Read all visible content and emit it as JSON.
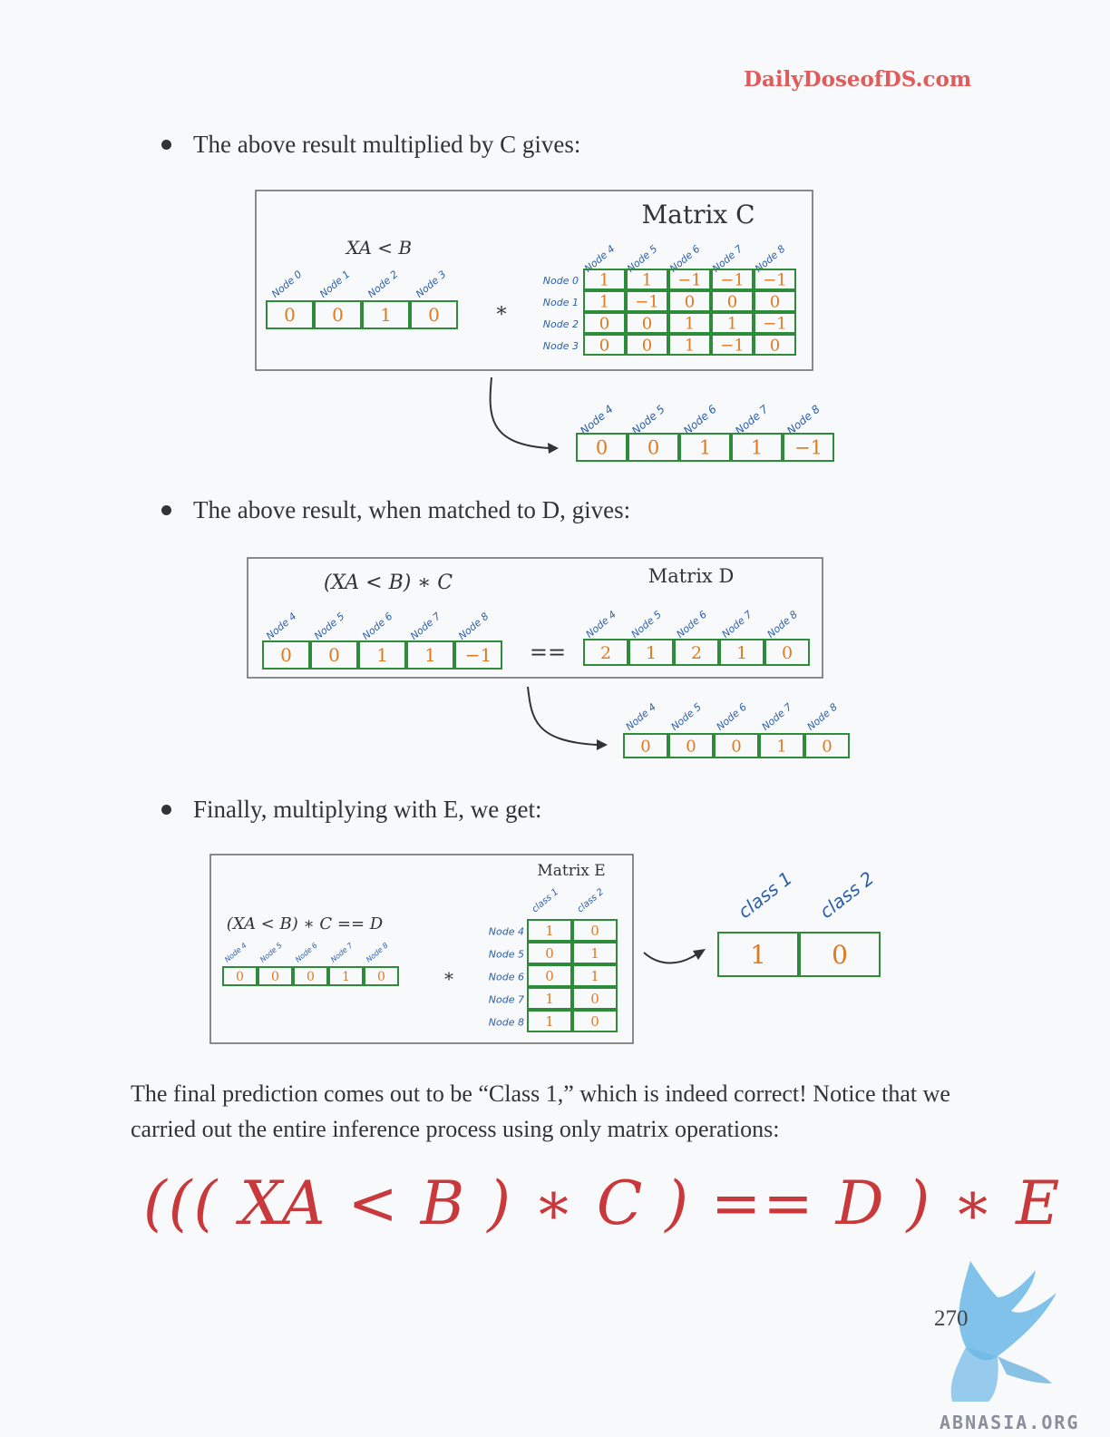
{
  "header": {
    "brand": "DailyDoseofDS.com"
  },
  "bullets": [
    "The above result multiplied by C gives:",
    "The above result, when matched to D, gives:",
    "Finally, multiplying with E, we get:"
  ],
  "figure1": {
    "left_label": "XA < B",
    "left_cols": [
      "Node 0",
      "Node 1",
      "Node 2",
      "Node 3"
    ],
    "left_values": [
      "0",
      "0",
      "1",
      "0"
    ],
    "operator": "*",
    "matrix_title": "Matrix  C",
    "matrix_cols": [
      "Node 4",
      "Node 5",
      "Node 6",
      "Node 7",
      "Node 8"
    ],
    "matrix_rows": [
      "Node 0",
      "Node 1",
      "Node 2",
      "Node 3"
    ],
    "matrix_values": [
      [
        "1",
        "1",
        "−1",
        "−1",
        "−1"
      ],
      [
        "1",
        "−1",
        "0",
        "0",
        "0"
      ],
      [
        "0",
        "0",
        "1",
        "1",
        "−1"
      ],
      [
        "0",
        "0",
        "1",
        "−1",
        "0"
      ]
    ],
    "result_cols": [
      "Node 4",
      "Node 5",
      "Node 6",
      "Node 7",
      "Node 8"
    ],
    "result_values": [
      "0",
      "0",
      "1",
      "1",
      "−1"
    ]
  },
  "figure2": {
    "left_label": "(XA < B) ∗ C",
    "left_cols": [
      "Node 4",
      "Node 5",
      "Node 6",
      "Node 7",
      "Node 8"
    ],
    "left_values": [
      "0",
      "0",
      "1",
      "1",
      "−1"
    ],
    "operator": "==",
    "matrix_title": "Matrix  D",
    "matrix_cols": [
      "Node 4",
      "Node 5",
      "Node 6",
      "Node 7",
      "Node 8"
    ],
    "matrix_values": [
      "2",
      "1",
      "2",
      "1",
      "0"
    ],
    "result_cols": [
      "Node 4",
      "Node 5",
      "Node 6",
      "Node 7",
      "Node 8"
    ],
    "result_values": [
      "0",
      "0",
      "0",
      "1",
      "0"
    ]
  },
  "figure3": {
    "left_label": "(XA < B) ∗ C == D",
    "left_cols": [
      "Node 4",
      "Node 5",
      "Node 6",
      "Node 7",
      "Node 8"
    ],
    "left_values": [
      "0",
      "0",
      "0",
      "1",
      "0"
    ],
    "operator": "*",
    "matrix_title": "Matrix  E",
    "matrix_cols": [
      "class 1",
      "class 2"
    ],
    "matrix_rows": [
      "Node 4",
      "Node 5",
      "Node 6",
      "Node 7",
      "Node 8"
    ],
    "matrix_values": [
      [
        "1",
        "0"
      ],
      [
        "0",
        "1"
      ],
      [
        "0",
        "1"
      ],
      [
        "1",
        "0"
      ],
      [
        "1",
        "0"
      ]
    ],
    "result_cols": [
      "class 1",
      "class 2"
    ],
    "result_values": [
      "1",
      "0"
    ]
  },
  "paragraph": "The final prediction comes out to be “Class 1,” which is indeed correct! Notice that we carried out the entire inference process using only matrix operations:",
  "formula": "((( XA < B ) ∗ C ) == D ) ∗ E",
  "footer": {
    "page_number": "270",
    "watermark": "ABNASIA.ORG"
  },
  "colors": {
    "brand": "#e35a5a",
    "cell_border": "#2e8b3a",
    "cell_value": "#e07a1f",
    "column_label": "#2a5ea8",
    "formula": "#c9383a"
  }
}
